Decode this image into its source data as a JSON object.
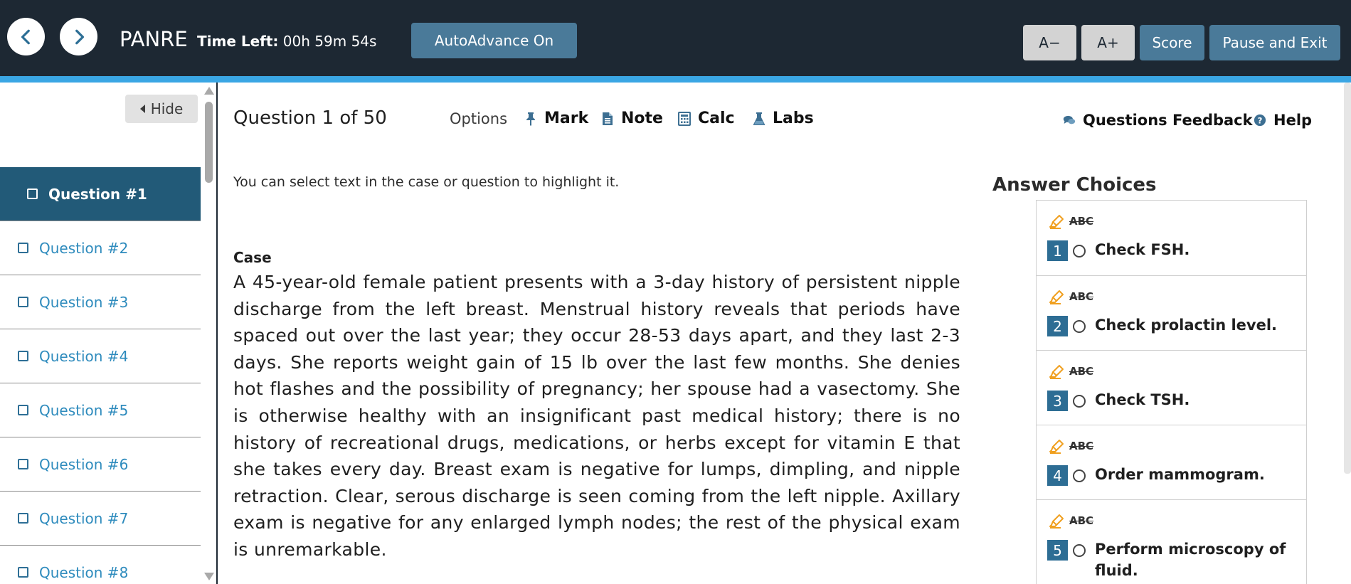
{
  "header": {
    "brand": "PANRE",
    "timer_label": "Time Left:",
    "timer_value": "00h 59m 54s",
    "auto_advance": "AutoAdvance On",
    "font_smaller": "A−",
    "font_larger": "A+",
    "score": "Score",
    "pause_exit": "Pause and Exit"
  },
  "sidebar": {
    "hide_label": "Hide",
    "questions": [
      {
        "label": "Question #1",
        "active": true
      },
      {
        "label": "Question #2",
        "active": false
      },
      {
        "label": "Question #3",
        "active": false
      },
      {
        "label": "Question #4",
        "active": false
      },
      {
        "label": "Question #5",
        "active": false
      },
      {
        "label": "Question #6",
        "active": false
      },
      {
        "label": "Question #7",
        "active": false
      },
      {
        "label": "Question #8",
        "active": false
      }
    ]
  },
  "toolbar": {
    "question_title": "Question 1 of 50",
    "options_label": "Options",
    "mark": "Mark",
    "note": "Note",
    "calc": "Calc",
    "labs": "Labs",
    "feedback": "Questions Feedback",
    "help": "Help"
  },
  "content": {
    "hint": "You can select text in the case or question to highlight it.",
    "case_heading": "Case",
    "case_text": "A 45-year-old female patient presents with a 3-day history of persistent nipple discharge from the left breast. Menstrual history reveals that periods have spaced out over the last year; they occur 28-53 days apart, and they last 2-3 days. She reports weight gain of 15 lb over the last few months. She denies hot flashes and the possibility of pregnancy; her spouse had a vasectomy. She is otherwise healthy with an insignificant past medical history; there is no history of recreational drugs, medications, or herbs except for vitamin E that she takes every day. Breast exam is negative for lumps, dimpling, and nipple retraction. Clear, serous discharge is seen coming from the left nipple. Axillary exam is negative for any enlarged lymph nodes; the rest of the physical exam is unremarkable."
  },
  "answers": {
    "title": "Answer Choices",
    "strike_label": "ABC",
    "choices": [
      {
        "number": "1",
        "text": "Check FSH."
      },
      {
        "number": "2",
        "text": "Check prolactin level."
      },
      {
        "number": "3",
        "text": "Check TSH."
      },
      {
        "number": "4",
        "text": "Order mammogram."
      },
      {
        "number": "5",
        "text": "Perform microscopy of fluid."
      }
    ]
  },
  "colors": {
    "topbar": "#1d2833",
    "accent": "#3aa6e4",
    "button_blue": "#4a7a99",
    "active_question": "#225a78",
    "link": "#2e8bbd",
    "highlighter": "#f0a020"
  },
  "icons": [
    "chevron-left-icon",
    "chevron-right-icon",
    "pin-icon",
    "note-icon",
    "calculator-icon",
    "flask-icon",
    "comments-icon",
    "help-icon",
    "highlighter-icon"
  ]
}
